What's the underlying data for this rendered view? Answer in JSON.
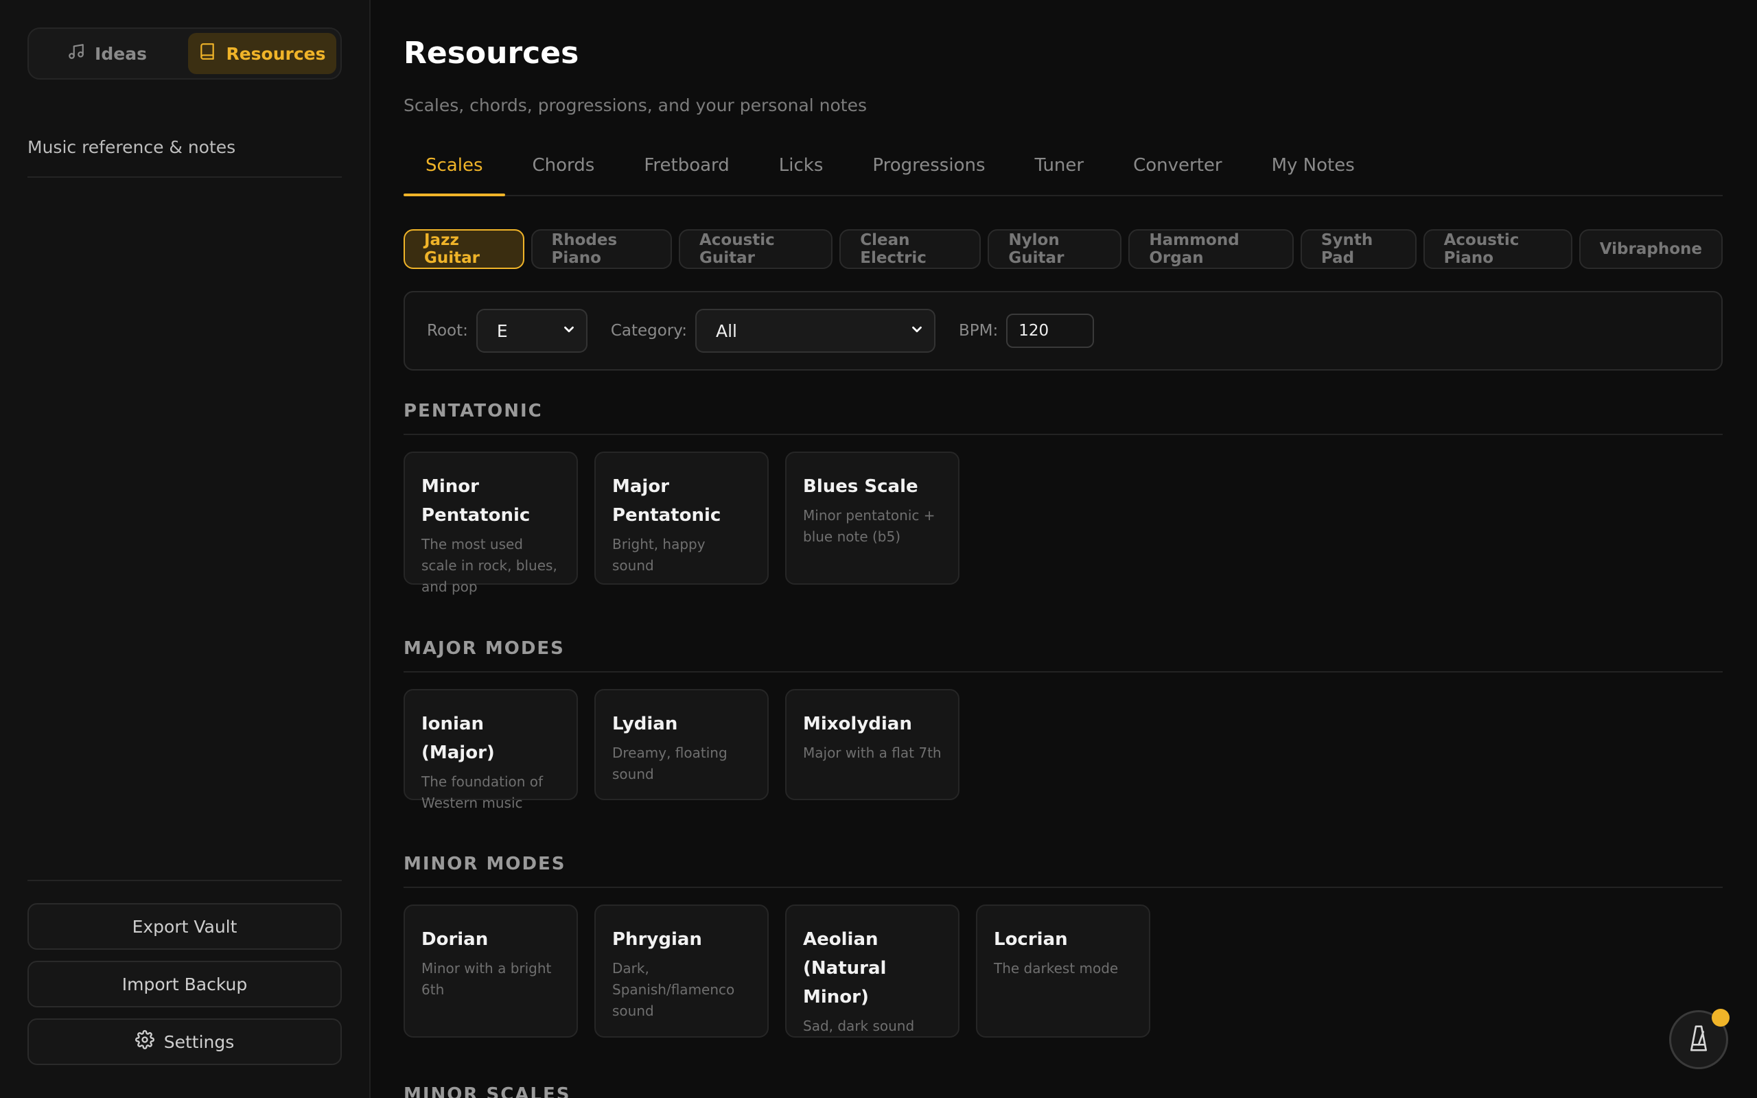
{
  "sidebar": {
    "modes": [
      {
        "label": "Ideas",
        "icon": "music-note-icon",
        "active": false
      },
      {
        "label": "Resources",
        "icon": "book-icon",
        "active": true
      }
    ],
    "subtitle": "Music reference & notes",
    "export_label": "Export Vault",
    "import_label": "Import Backup",
    "settings_label": "Settings"
  },
  "header": {
    "title": "Resources",
    "subtitle": "Scales, chords, progressions, and your personal notes"
  },
  "tabs": [
    "Scales",
    "Chords",
    "Fretboard",
    "Licks",
    "Progressions",
    "Tuner",
    "Converter",
    "My Notes"
  ],
  "active_tab": "Scales",
  "instruments": [
    "Jazz Guitar",
    "Rhodes Piano",
    "Acoustic Guitar",
    "Clean Electric",
    "Nylon Guitar",
    "Hammond Organ",
    "Synth Pad",
    "Acoustic Piano",
    "Vibraphone"
  ],
  "active_instrument": "Jazz Guitar",
  "filters": {
    "root_label": "Root:",
    "root_value": "E",
    "category_label": "Category:",
    "category_value": "All",
    "bpm_label": "BPM:",
    "bpm_value": "120"
  },
  "sections": {
    "pentatonic": {
      "title": "PENTATONIC",
      "cards": [
        {
          "title": "Minor Pentatonic",
          "desc": "The most used scale in rock, blues, and pop"
        },
        {
          "title": "Major Pentatonic",
          "desc": "Bright, happy sound"
        },
        {
          "title": "Blues Scale",
          "desc": "Minor pentatonic + blue note (b5)"
        }
      ]
    },
    "major_modes": {
      "title": "MAJOR MODES",
      "cards": [
        {
          "title": "Ionian (Major)",
          "desc": "The foundation of Western music"
        },
        {
          "title": "Lydian",
          "desc": "Dreamy, floating sound"
        },
        {
          "title": "Mixolydian",
          "desc": "Major with a flat 7th"
        }
      ]
    },
    "minor_modes": {
      "title": "MINOR MODES",
      "cards": [
        {
          "title": "Dorian",
          "desc": "Minor with a bright 6th"
        },
        {
          "title": "Phrygian",
          "desc": "Dark, Spanish/flamenco sound"
        },
        {
          "title": "Aeolian (Natural Minor)",
          "desc": "Sad, dark sound"
        },
        {
          "title": "Locrian",
          "desc": "The darkest mode"
        }
      ]
    },
    "minor_scales": {
      "title": "MINOR SCALES"
    }
  },
  "colors": {
    "accent": "#f0b429",
    "background": "#0d0d0d",
    "sidebar": "#121212"
  },
  "floating": {
    "icon": "metronome-icon"
  }
}
